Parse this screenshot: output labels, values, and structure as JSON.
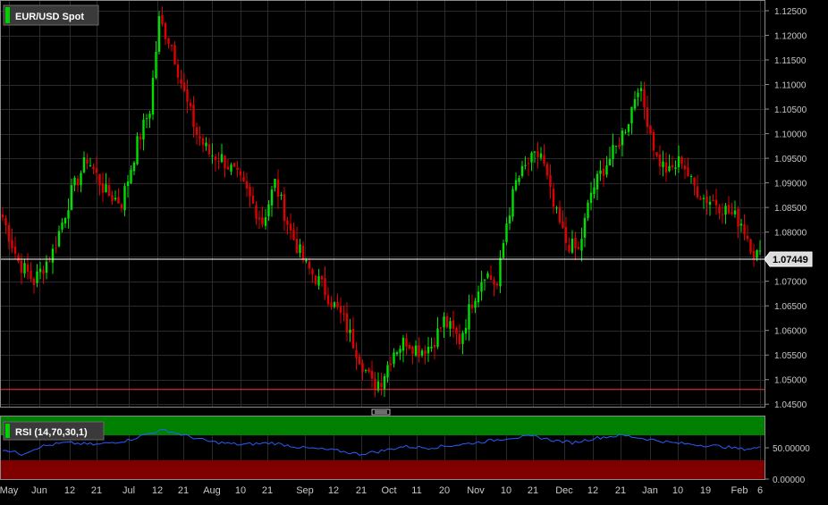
{
  "chart_data": [
    {
      "type": "candlestick",
      "title": "EUR/USD Spot",
      "current_price": "1.07449",
      "colors": {
        "up": "#00e000",
        "down": "#e00000",
        "background": "#000000",
        "grid": "#2a2a2a",
        "price_line": "#ffffff",
        "support_line": "#ff3030",
        "axis_text": "#c8c8c8"
      },
      "grid": true,
      "y_ticks": [
        "1.12500",
        "1.12000",
        "1.11500",
        "1.11000",
        "1.10500",
        "1.10000",
        "1.09500",
        "1.09000",
        "1.08500",
        "1.08000",
        "1.07500",
        "1.07000",
        "1.06500",
        "1.06000",
        "1.05500",
        "1.05000",
        "1.04500"
      ],
      "ylim": [
        1.0445,
        1.127
      ],
      "support_level": 1.048,
      "x_ticks": [
        "May",
        "Jun",
        "12",
        "21",
        "Jul",
        "12",
        "21",
        "Aug",
        "10",
        "21",
        "Sep",
        "12",
        "21",
        "Oct",
        "11",
        "20",
        "Nov",
        "10",
        "21",
        "Dec",
        "12",
        "21",
        "Jan",
        "10",
        "19",
        "Feb",
        "6"
      ],
      "close_anchors": [
        [
          0,
          1.083
        ],
        [
          5,
          1.074
        ],
        [
          10,
          1.07
        ],
        [
          16,
          1.076
        ],
        [
          22,
          1.088
        ],
        [
          27,
          1.095
        ],
        [
          33,
          1.088
        ],
        [
          38,
          1.086
        ],
        [
          43,
          1.098
        ],
        [
          47,
          1.105
        ],
        [
          50,
          1.123
        ],
        [
          54,
          1.118
        ],
        [
          58,
          1.108
        ],
        [
          62,
          1.1
        ],
        [
          66,
          1.096
        ],
        [
          70,
          1.095
        ],
        [
          74,
          1.092
        ],
        [
          78,
          1.088
        ],
        [
          83,
          1.082
        ],
        [
          87,
          1.09
        ],
        [
          92,
          1.08
        ],
        [
          97,
          1.073
        ],
        [
          101,
          1.07
        ],
        [
          105,
          1.066
        ],
        [
          109,
          1.062
        ],
        [
          113,
          1.056
        ],
        [
          118,
          1.049
        ],
        [
          121,
          1.05
        ],
        [
          125,
          1.056
        ],
        [
          129,
          1.058
        ],
        [
          133,
          1.056
        ],
        [
          137,
          1.057
        ],
        [
          141,
          1.062
        ],
        [
          146,
          1.058
        ],
        [
          150,
          1.066
        ],
        [
          154,
          1.072
        ],
        [
          158,
          1.069
        ],
        [
          161,
          1.082
        ],
        [
          164,
          1.09
        ],
        [
          168,
          1.094
        ],
        [
          172,
          1.096
        ],
        [
          176,
          1.085
        ],
        [
          180,
          1.078
        ],
        [
          184,
          1.076
        ],
        [
          188,
          1.088
        ],
        [
          192,
          1.093
        ],
        [
          196,
          1.097
        ],
        [
          200,
          1.103
        ],
        [
          203,
          1.11
        ],
        [
          206,
          1.103
        ],
        [
          209,
          1.095
        ],
        [
          213,
          1.092
        ],
        [
          217,
          1.095
        ],
        [
          220,
          1.09
        ],
        [
          224,
          1.087
        ],
        [
          228,
          1.086
        ],
        [
          232,
          1.084
        ],
        [
          236,
          1.082
        ],
        [
          240,
          1.076
        ],
        [
          242,
          1.075
        ]
      ]
    },
    {
      "type": "line",
      "title": "RSI (14,70,30,1)",
      "ylim": [
        0,
        100
      ],
      "y_ticks": [
        "50.00000",
        "0.00000"
      ],
      "upper_band": 70,
      "lower_band": 30,
      "colors": {
        "line": "#2a5cff",
        "upper_zone": "#008000",
        "lower_zone": "#800000"
      },
      "x_ticks": [
        "May",
        "Jun",
        "12",
        "21",
        "Jul",
        "12",
        "21",
        "Aug",
        "10",
        "21",
        "Sep",
        "12",
        "21",
        "Oct",
        "11",
        "20",
        "Nov",
        "10",
        "21",
        "Dec",
        "12",
        "21",
        "Jan",
        "10",
        "19",
        "Feb",
        "6"
      ],
      "anchors": [
        [
          0,
          48
        ],
        [
          6,
          40
        ],
        [
          12,
          52
        ],
        [
          20,
          58
        ],
        [
          30,
          55
        ],
        [
          40,
          62
        ],
        [
          48,
          75
        ],
        [
          52,
          78
        ],
        [
          58,
          70
        ],
        [
          66,
          60
        ],
        [
          76,
          55
        ],
        [
          86,
          58
        ],
        [
          96,
          50
        ],
        [
          106,
          46
        ],
        [
          114,
          40
        ],
        [
          120,
          44
        ],
        [
          128,
          52
        ],
        [
          136,
          50
        ],
        [
          146,
          55
        ],
        [
          154,
          60
        ],
        [
          162,
          66
        ],
        [
          170,
          68
        ],
        [
          176,
          62
        ],
        [
          182,
          58
        ],
        [
          190,
          66
        ],
        [
          198,
          70
        ],
        [
          206,
          64
        ],
        [
          214,
          58
        ],
        [
          222,
          55
        ],
        [
          230,
          52
        ],
        [
          236,
          48
        ],
        [
          242,
          50
        ]
      ]
    }
  ]
}
